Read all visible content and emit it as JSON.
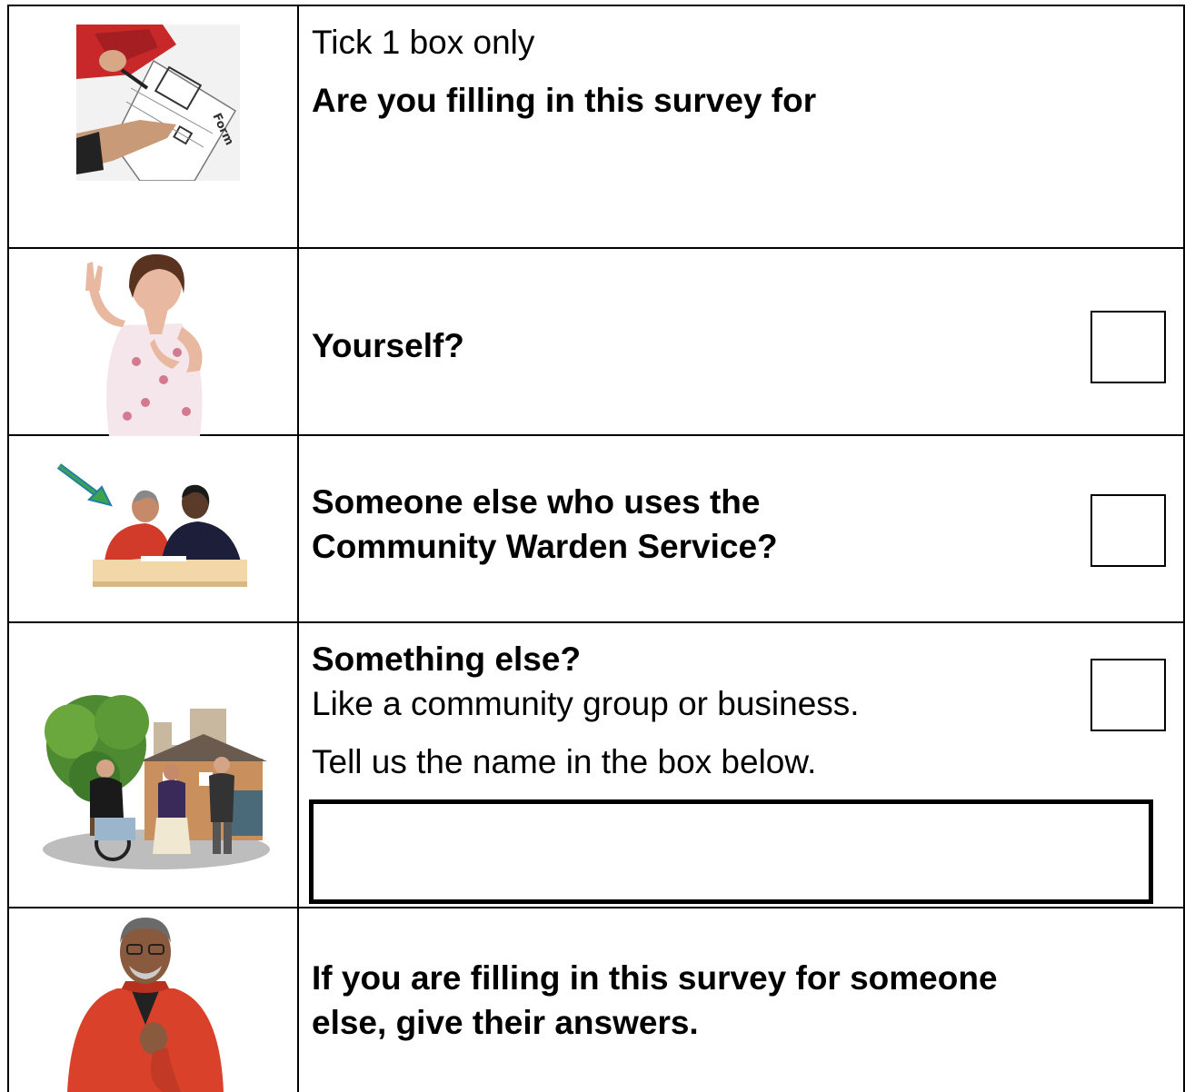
{
  "header": {
    "instruction": "Tick 1 box only",
    "question": "Are you filling in this survey for"
  },
  "options": [
    {
      "label": "Yourself?",
      "checked": false
    },
    {
      "label_line1": "Someone else who uses the",
      "label_line2": "Community Warden Service?",
      "checked": false
    },
    {
      "label": "Something else?",
      "hint": "Like a community group or business.",
      "instruction": "Tell us the name in the box below.",
      "checked": false,
      "name_value": ""
    }
  ],
  "note": {
    "line1": "If you are filling in this survey for someone",
    "line2": "else, give their answers."
  },
  "icons": [
    "form-signing-picture",
    "woman-raising-hand-picture",
    "two-people-at-desk-picture",
    "community-group-picture",
    "man-pointing-to-self-picture"
  ]
}
